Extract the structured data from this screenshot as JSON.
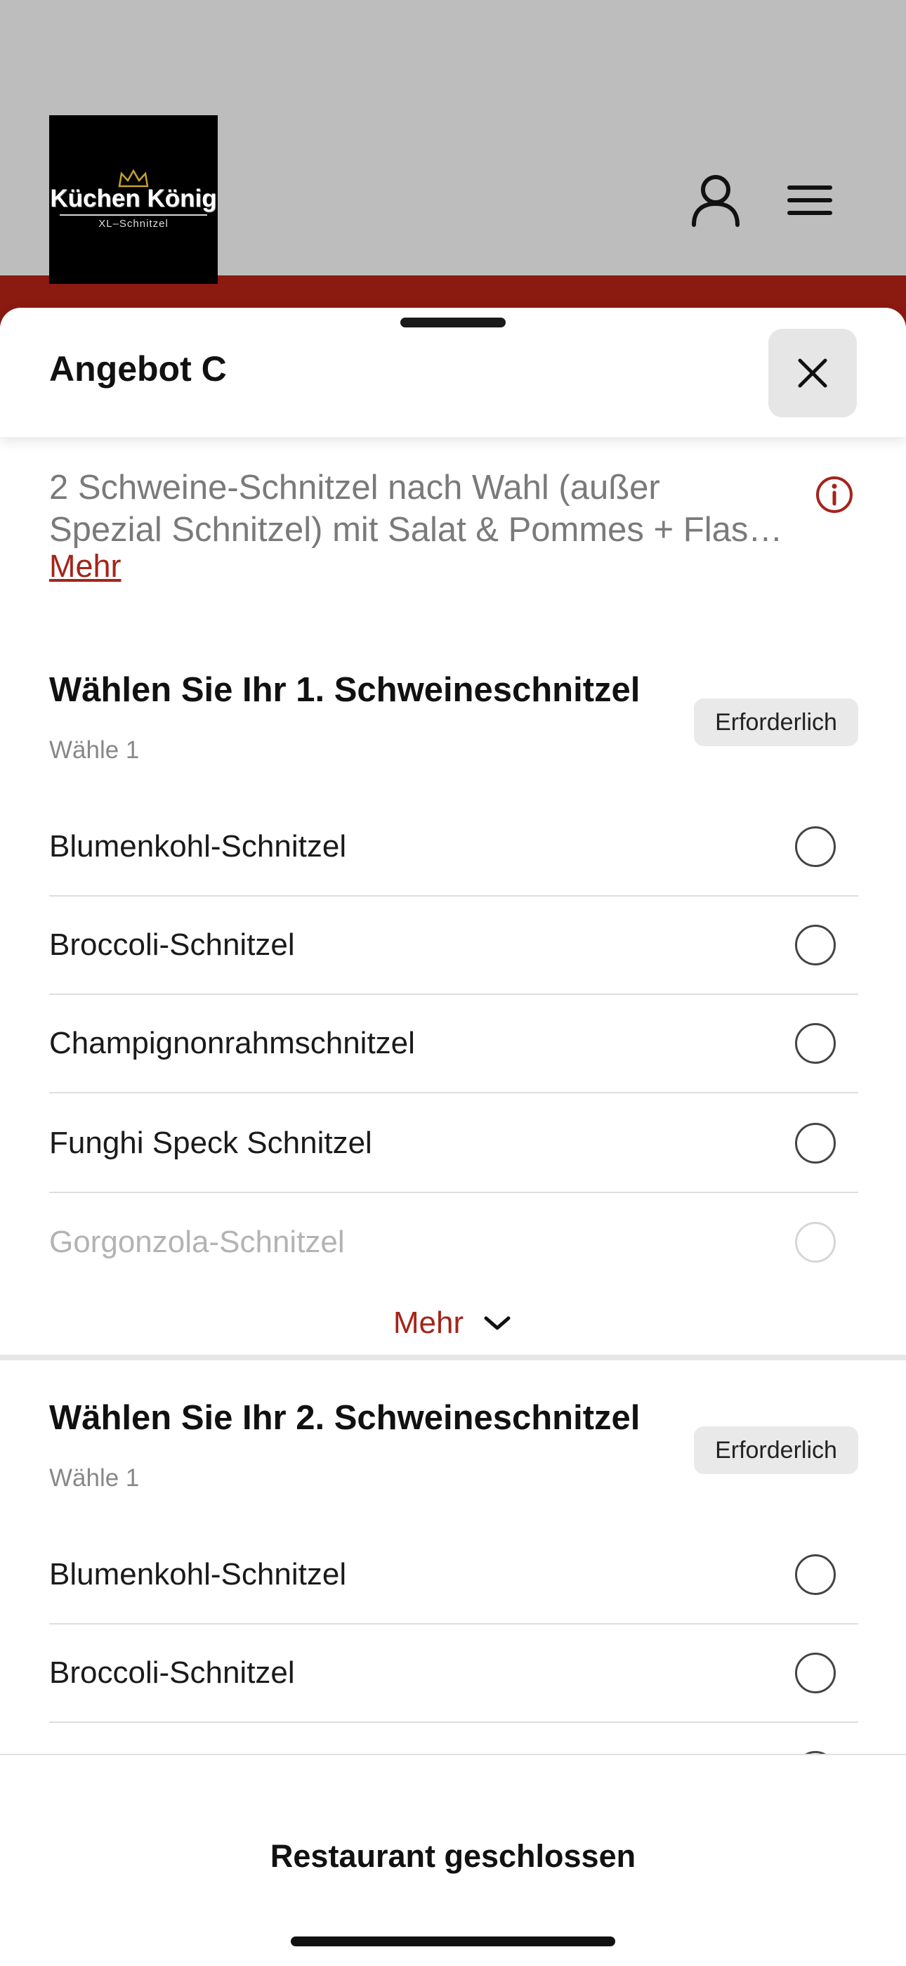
{
  "header": {
    "logo": {
      "name": "Küchen König",
      "subtitle": "XL–Schnitzel"
    },
    "icons": {
      "account": "user-icon",
      "menu": "hamburger-menu-icon"
    }
  },
  "sheet": {
    "title": "Angebot C",
    "close_icon": "close-icon",
    "description_line1": "2 Schweine-Schnitzel nach Wahl (außer",
    "description_line2": "Spezial Schnitzel) mit Salat & Pommes + Flas…",
    "more_link": "Mehr",
    "info_icon": "info-icon"
  },
  "sections": [
    {
      "title": "Wählen Sie Ihr 1. Schweineschnitzel",
      "subtitle": "Wähle 1",
      "badge": "Erforderlich",
      "options": [
        "Blumenkohl-Schnitzel",
        "Broccoli-Schnitzel",
        "Champignonrahmschnitzel",
        "Funghi Speck Schnitzel",
        "Gorgonzola-Schnitzel"
      ],
      "more_label": "Mehr"
    },
    {
      "title": "Wählen Sie Ihr 2. Schweineschnitzel",
      "subtitle": "Wähle 1",
      "badge": "Erforderlich",
      "options": [
        "Blumenkohl-Schnitzel",
        "Broccoli-Schnitzel"
      ]
    }
  ],
  "footer": {
    "status": "Restaurant geschlossen"
  },
  "colors": {
    "accent": "#a4251a",
    "strip": "#8b1a10",
    "backdrop": "#bdbdbd"
  }
}
